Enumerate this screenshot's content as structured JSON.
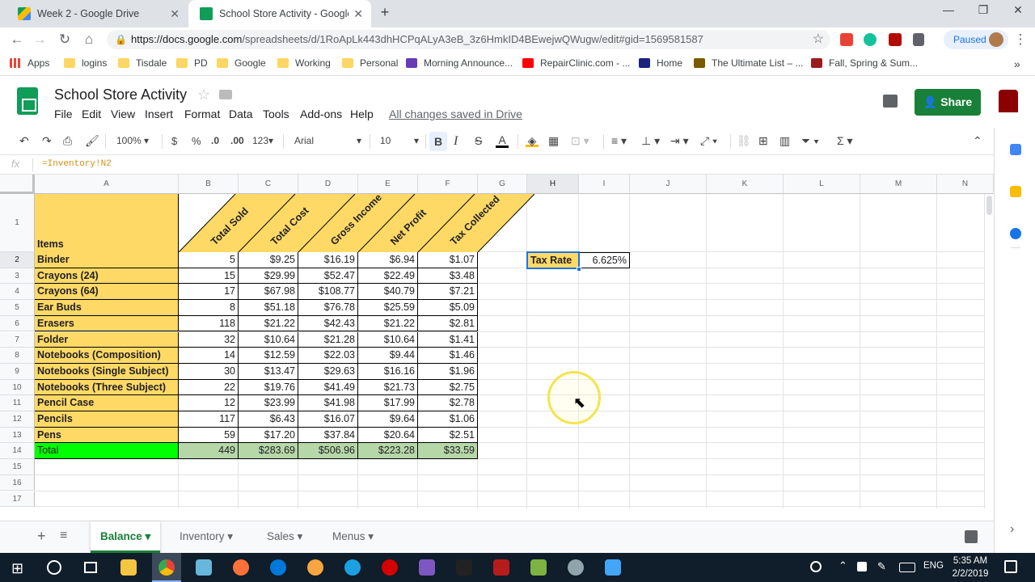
{
  "browser": {
    "tabs": [
      {
        "title": "Week 2 - Google Drive",
        "active": false,
        "icon": "google-drive-icon"
      },
      {
        "title": "School Store Activity - Google Sheets",
        "active": true,
        "icon": "google-sheets-icon"
      }
    ],
    "url_host": "https://docs.google.com",
    "url_path": "/spreadsheets/d/1RoApLk443dhHCPqALyA3eB_3z6HmkID4BEwejwQWugw/edit#gid=1569581587",
    "profile_status": "Paused",
    "bookmarks": [
      "Apps",
      "logins",
      "Tisdale",
      "PD",
      "Google",
      "Working",
      "Personal",
      "Morning Announce...",
      "RepairClinic.com - ...",
      "Home",
      "The Ultimate List – ...",
      "Fall, Spring & Sum..."
    ]
  },
  "doc": {
    "title": "School Store Activity",
    "menus": [
      "File",
      "Edit",
      "View",
      "Insert",
      "Format",
      "Data",
      "Tools",
      "Add-ons",
      "Help"
    ],
    "save_status": "All changes saved in Drive",
    "share_label": "Share"
  },
  "toolbar": {
    "zoom": "100%",
    "currency": "$",
    "percent": "%",
    "dec_less": ".0",
    "dec_more": ".00",
    "more_formats": "123",
    "font": "Arial",
    "font_size": "10",
    "bold": "B",
    "italic": "I",
    "strike": "S",
    "text_color": "A"
  },
  "formula_bar": {
    "fx": "fx",
    "formula": "=Inventory!N2"
  },
  "sheet": {
    "columns": [
      "A",
      "B",
      "C",
      "D",
      "E",
      "F",
      "G",
      "H",
      "I",
      "J",
      "K",
      "L",
      "M",
      "N"
    ],
    "rows": [
      "1",
      "2",
      "3",
      "4",
      "5",
      "6",
      "7",
      "8",
      "9",
      "10",
      "11",
      "12",
      "13",
      "14",
      "15",
      "16",
      "17"
    ],
    "header_items": "Items",
    "diag_headers": [
      "Total Sold",
      "Total Cost",
      "Gross Income",
      "Net Profit",
      "Tax Collected"
    ],
    "items": [
      {
        "name": "Binder",
        "sold": "5",
        "cost": "$9.25",
        "income": "$16.19",
        "profit": "$6.94",
        "tax": "$1.07"
      },
      {
        "name": "Crayons (24)",
        "sold": "15",
        "cost": "$29.99",
        "income": "$52.47",
        "profit": "$22.49",
        "tax": "$3.48"
      },
      {
        "name": "Crayons (64)",
        "sold": "17",
        "cost": "$67.98",
        "income": "$108.77",
        "profit": "$40.79",
        "tax": "$7.21"
      },
      {
        "name": "Ear Buds",
        "sold": "8",
        "cost": "$51.18",
        "income": "$76.78",
        "profit": "$25.59",
        "tax": "$5.09"
      },
      {
        "name": "Erasers",
        "sold": "118",
        "cost": "$21.22",
        "income": "$42.43",
        "profit": "$21.22",
        "tax": "$2.81"
      },
      {
        "name": "Folder",
        "sold": "32",
        "cost": "$10.64",
        "income": "$21.28",
        "profit": "$10.64",
        "tax": "$1.41"
      },
      {
        "name": "Notebooks (Composition)",
        "sold": "14",
        "cost": "$12.59",
        "income": "$22.03",
        "profit": "$9.44",
        "tax": "$1.46"
      },
      {
        "name": "Notebooks (Single Subject)",
        "sold": "30",
        "cost": "$13.47",
        "income": "$29.63",
        "profit": "$16.16",
        "tax": "$1.96"
      },
      {
        "name": "Notebooks (Three Subject)",
        "sold": "22",
        "cost": "$19.76",
        "income": "$41.49",
        "profit": "$21.73",
        "tax": "$2.75"
      },
      {
        "name": "Pencil Case",
        "sold": "12",
        "cost": "$23.99",
        "income": "$41.98",
        "profit": "$17.99",
        "tax": "$2.78"
      },
      {
        "name": "Pencils",
        "sold": "117",
        "cost": "$6.43",
        "income": "$16.07",
        "profit": "$9.64",
        "tax": "$1.06"
      },
      {
        "name": "Pens",
        "sold": "59",
        "cost": "$17.20",
        "income": "$37.84",
        "profit": "$20.64",
        "tax": "$2.51"
      }
    ],
    "total": {
      "name": "Total",
      "sold": "449",
      "cost": "$283.69",
      "income": "$506.96",
      "profit": "$223.28",
      "tax": "$33.59"
    },
    "tax_rate_label": "Tax Rate",
    "tax_rate_value": "6.625%"
  },
  "sheet_tabs": [
    {
      "label": "Balance",
      "active": true
    },
    {
      "label": "Inventory",
      "active": false
    },
    {
      "label": "Sales",
      "active": false
    },
    {
      "label": "Menus",
      "active": false
    }
  ],
  "taskbar": {
    "language": "ENG",
    "time": "5:35 AM",
    "date": "2/2/2019"
  },
  "colors": {
    "sheets_green": "#0f9d58",
    "share_green": "#188038",
    "header_fill": "#ffd966",
    "total_name_fill": "#00ff00",
    "total_row_fill": "#b6d7a8"
  }
}
